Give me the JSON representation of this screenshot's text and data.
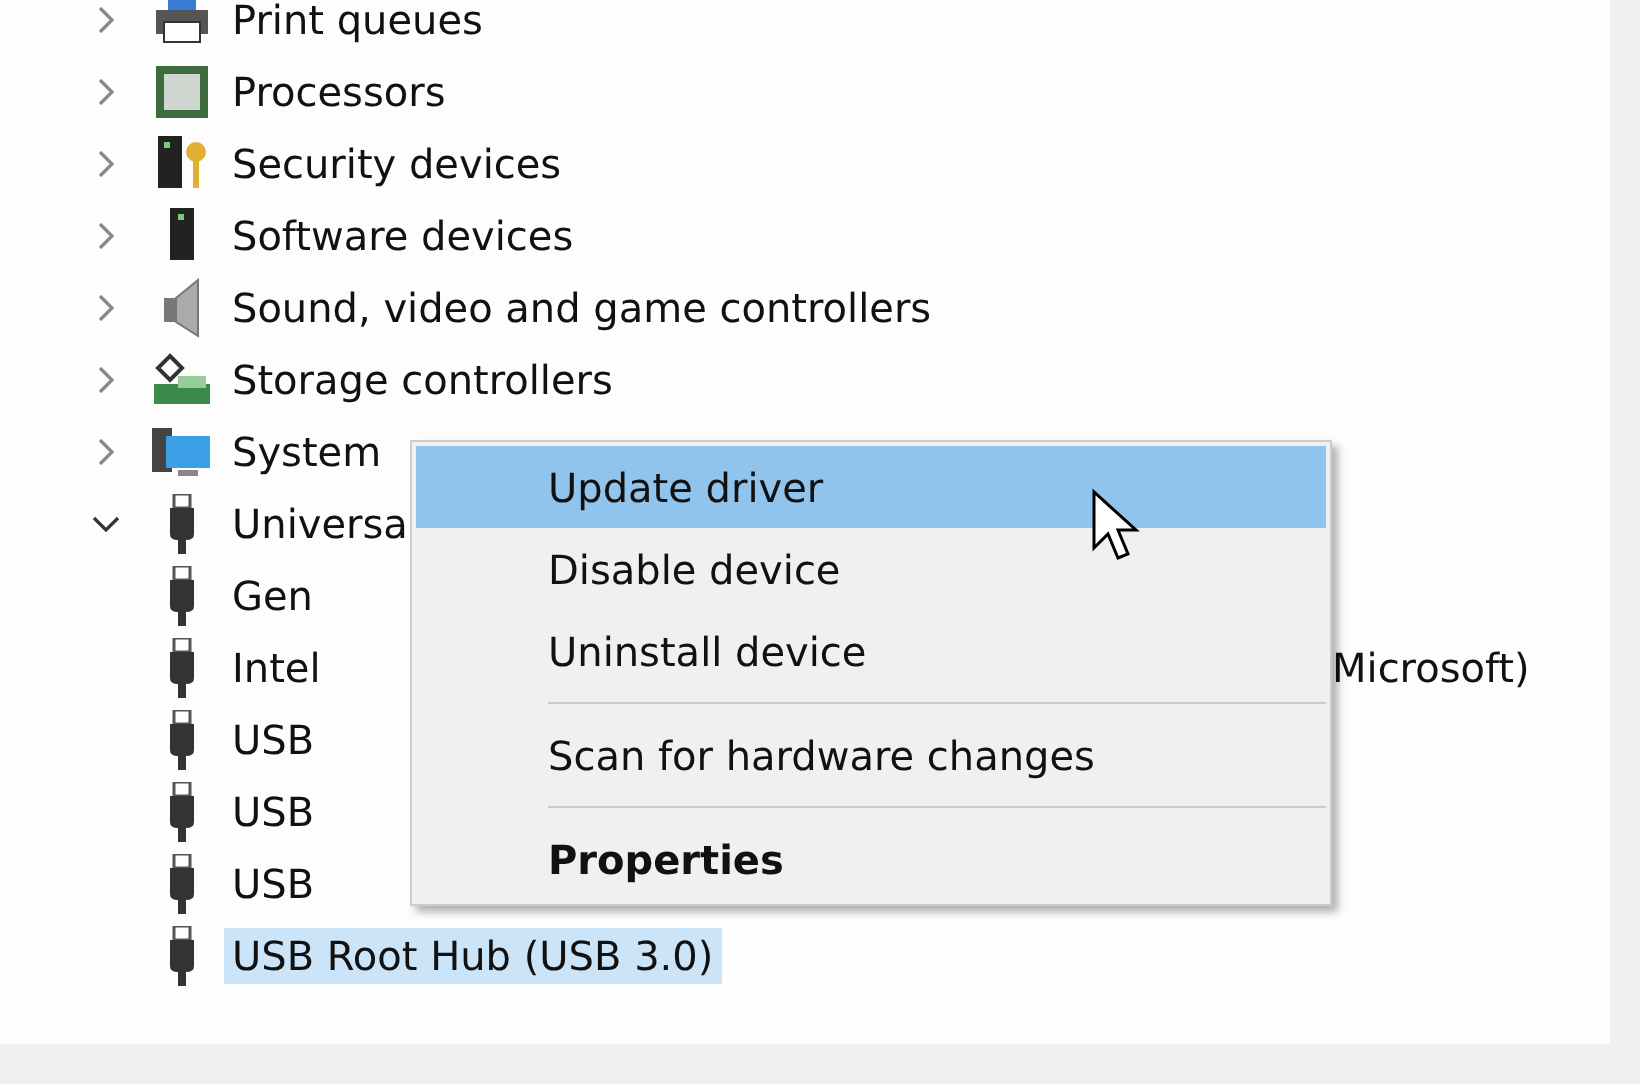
{
  "tree": [
    {
      "label": "Print queues",
      "expanded": false,
      "selected": false
    },
    {
      "label": "Processors",
      "expanded": false,
      "selected": false
    },
    {
      "label": "Security devices",
      "expanded": false,
      "selected": false
    },
    {
      "label": "Software devices",
      "expanded": false,
      "selected": false
    },
    {
      "label": "Sound, video and game controllers",
      "expanded": false,
      "selected": false
    },
    {
      "label": "Storage controllers",
      "expanded": false,
      "selected": false
    },
    {
      "label": "System",
      "expanded": false,
      "selected": false
    },
    {
      "label": "Universa",
      "expanded": true,
      "selected": false,
      "children": [
        {
          "label": "Gen",
          "selected": false
        },
        {
          "label": "Intel",
          "label_right": "Microsoft)",
          "selected": false
        },
        {
          "label": "USB",
          "selected": false
        },
        {
          "label": "USB",
          "selected": false
        },
        {
          "label": "USB",
          "selected": false
        },
        {
          "label": "USB Root Hub (USB 3.0)",
          "selected": true
        }
      ]
    }
  ],
  "context_menu": [
    {
      "kind": "command",
      "label": "Update driver",
      "selected": true,
      "default": false
    },
    {
      "kind": "command",
      "label": "Disable device",
      "selected": false,
      "default": false
    },
    {
      "kind": "command",
      "label": "Uninstall device",
      "selected": false,
      "default": false
    },
    {
      "kind": "separator"
    },
    {
      "kind": "command",
      "label": "Scan for hardware changes",
      "selected": false,
      "default": false
    },
    {
      "kind": "separator"
    },
    {
      "kind": "command",
      "label": "Properties",
      "selected": false,
      "default": true
    }
  ]
}
